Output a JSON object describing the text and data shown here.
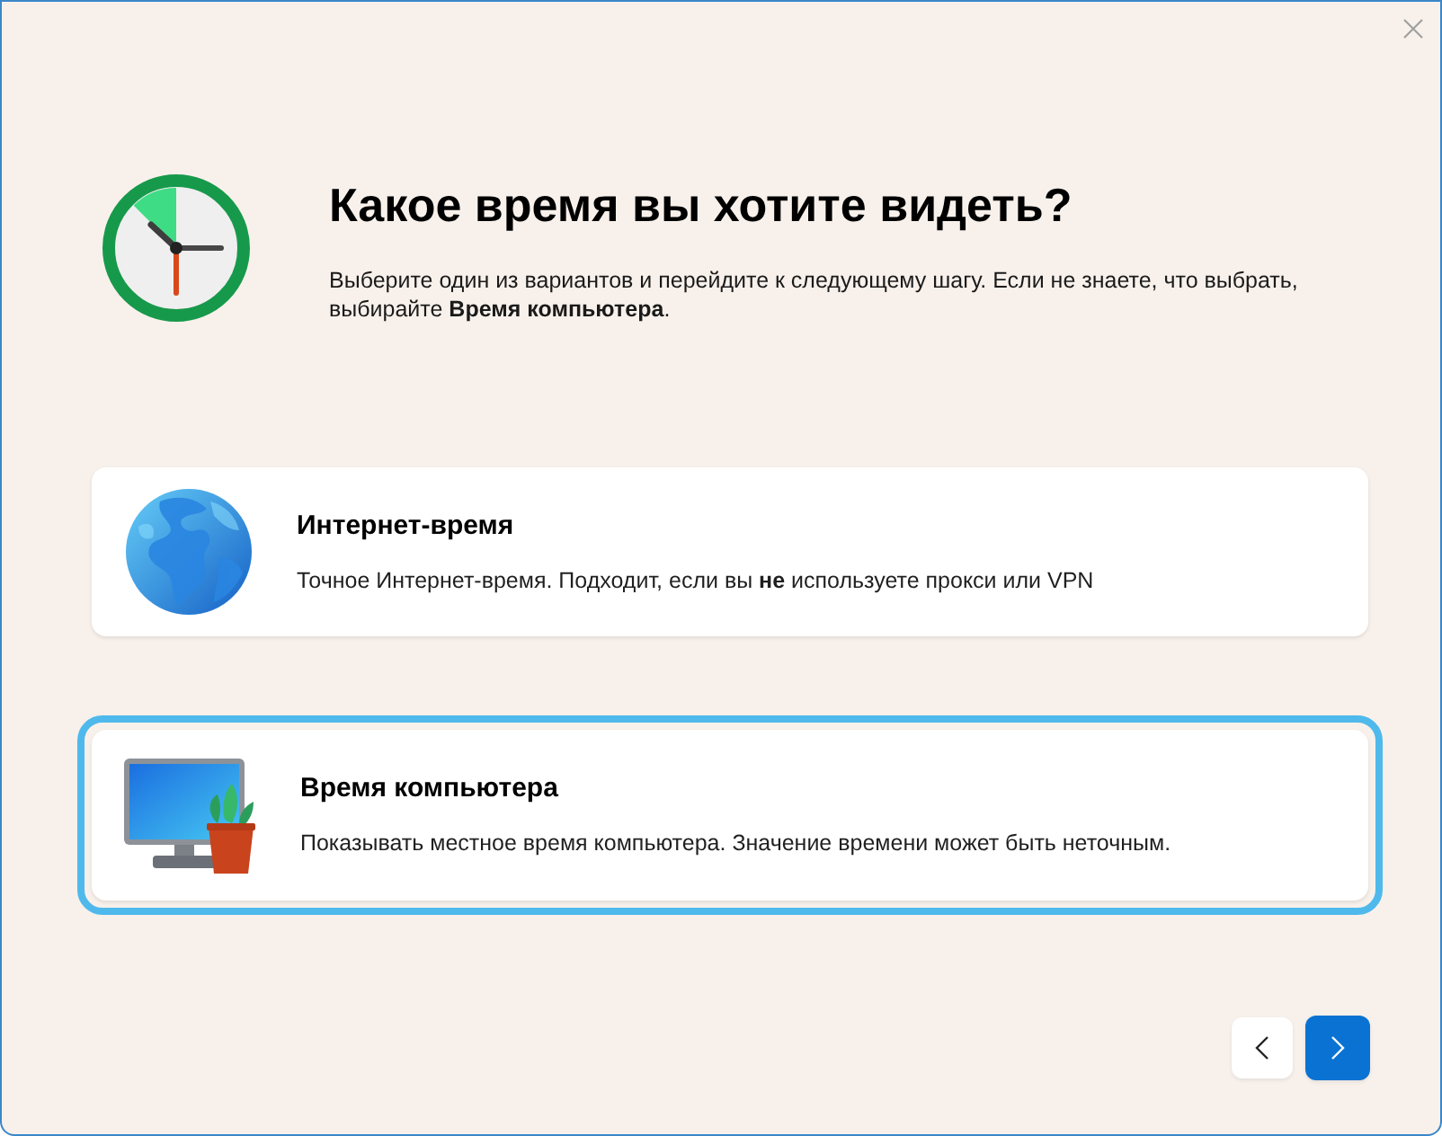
{
  "header": {
    "title": "Какое время вы хотите видеть?",
    "description": "Выберите один из вариантов и перейдите к следующему шагу. Если не знаете, что выбрать, выбирайте **Время компьютера**."
  },
  "options": [
    {
      "kind": "internet",
      "title": "Интернет-время",
      "description": "Точное Интернет-время. Подходит, если вы **не** используете прокси или VPN",
      "selected": false
    },
    {
      "kind": "computer",
      "title": "Время компьютера",
      "description": "Показывать местное время компьютера. Значение времени может быть неточным.",
      "selected": true
    }
  ]
}
